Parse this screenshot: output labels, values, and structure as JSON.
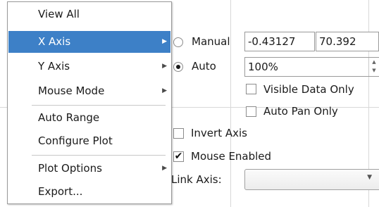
{
  "menu": {
    "items": [
      {
        "label": "View All"
      },
      {
        "label": "X Axis",
        "has_submenu": true,
        "selected": true
      },
      {
        "label": "Y Axis",
        "has_submenu": true
      },
      {
        "label": "Mouse Mode",
        "has_submenu": true
      },
      {
        "label": "Auto Range"
      },
      {
        "label": "Configure Plot"
      },
      {
        "label": "Plot Options",
        "has_submenu": true
      },
      {
        "label": "Export..."
      }
    ],
    "submenu_arrow_icon": "chevron-right-icon",
    "selected_color": "#3d80c7"
  },
  "axis_panel": {
    "manual_label": "Manual",
    "manual_checked": false,
    "min_value": "-0.43127",
    "max_value": "70.392",
    "auto_label": "Auto",
    "auto_checked": true,
    "auto_percent": "100%",
    "visible_data_only_label": "Visible Data Only",
    "visible_data_only_checked": false,
    "auto_pan_only_label": "Auto Pan Only",
    "auto_pan_only_checked": false,
    "invert_axis_label": "Invert Axis",
    "invert_axis_checked": false,
    "mouse_enabled_label": "Mouse Enabled",
    "mouse_enabled_checked": true,
    "mouse_enabled_mark": "✔",
    "link_axis_label": "Link Axis:",
    "link_axis_value": ""
  }
}
